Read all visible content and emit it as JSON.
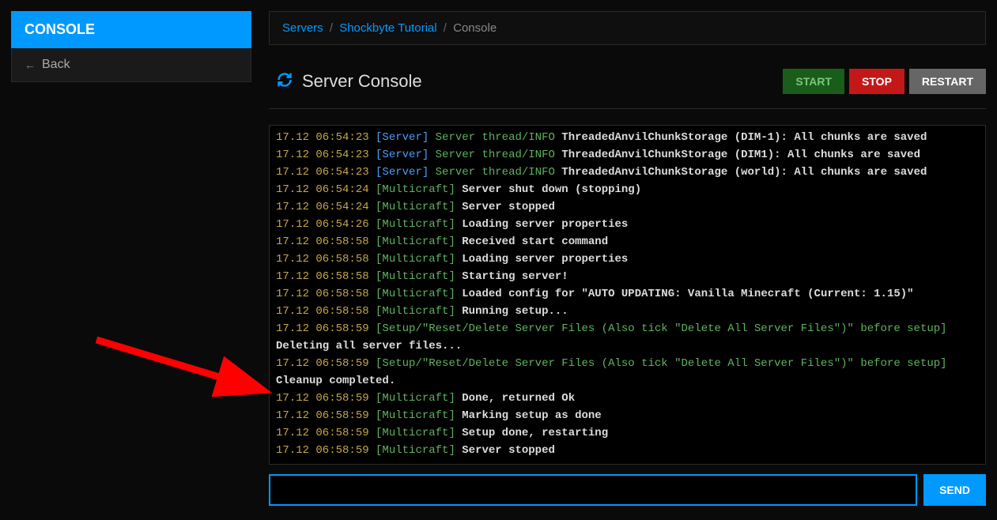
{
  "sidebar": {
    "title": "CONSOLE",
    "back_label": "Back"
  },
  "breadcrumb": {
    "servers": "Servers",
    "server_name": "Shockbyte Tutorial",
    "current": "Console"
  },
  "header": {
    "title": "Server Console",
    "start": "START",
    "stop": "STOP",
    "restart": "RESTART"
  },
  "input": {
    "send": "SEND"
  },
  "logs": [
    {
      "ts": "17.12 06:54:23",
      "tag": "[Server]",
      "tag_class": "tag-server",
      "thread": "Server thread/INFO",
      "msg": "ThreadedAnvilChunkStorage (world): All chunks are saved",
      "partial": true
    },
    {
      "ts": "17.12 06:54:23",
      "tag": "[Server]",
      "tag_class": "tag-server",
      "thread": "Server thread/INFO",
      "msg": "ThreadedAnvilChunkStorage (DIM-1): All chunks are saved"
    },
    {
      "ts": "17.12 06:54:23",
      "tag": "[Server]",
      "tag_class": "tag-server",
      "thread": "Server thread/INFO",
      "msg": "ThreadedAnvilChunkStorage (DIM1): All chunks are saved"
    },
    {
      "ts": "17.12 06:54:23",
      "tag": "[Server]",
      "tag_class": "tag-server",
      "thread": "Server thread/INFO",
      "msg": "ThreadedAnvilChunkStorage (world): All chunks are saved"
    },
    {
      "ts": "17.12 06:54:24",
      "tag": "[Multicraft]",
      "tag_class": "tag-multi",
      "msg": "Server shut down (stopping)"
    },
    {
      "ts": "17.12 06:54:24",
      "tag": "[Multicraft]",
      "tag_class": "tag-multi",
      "msg": "Server stopped"
    },
    {
      "ts": "17.12 06:54:26",
      "tag": "[Multicraft]",
      "tag_class": "tag-multi",
      "msg": "Loading server properties"
    },
    {
      "ts": "17.12 06:58:58",
      "tag": "[Multicraft]",
      "tag_class": "tag-multi",
      "msg": "Received start command"
    },
    {
      "ts": "17.12 06:58:58",
      "tag": "[Multicraft]",
      "tag_class": "tag-multi",
      "msg": "Loading server properties"
    },
    {
      "ts": "17.12 06:58:58",
      "tag": "[Multicraft]",
      "tag_class": "tag-multi",
      "msg": "Starting server!"
    },
    {
      "ts": "17.12 06:58:58",
      "tag": "[Multicraft]",
      "tag_class": "tag-multi",
      "msg": "Loaded config for \"AUTO UPDATING: Vanilla Minecraft (Current: 1.15)\""
    },
    {
      "ts": "17.12 06:58:58",
      "tag": "[Multicraft]",
      "tag_class": "tag-multi",
      "msg": "Running setup..."
    },
    {
      "ts": "17.12 06:58:59",
      "tag": "[Setup/\"Reset/Delete Server Files (Also tick \"Delete All Server Files\")\" before setup]",
      "tag_class": "tag-setup",
      "msg": ""
    },
    {
      "plain": "Deleting all server files..."
    },
    {
      "ts": "17.12 06:58:59",
      "tag": "[Setup/\"Reset/Delete Server Files (Also tick \"Delete All Server Files\")\" before setup]",
      "tag_class": "tag-setup",
      "msg": ""
    },
    {
      "plain": "Cleanup completed."
    },
    {
      "ts": "17.12 06:58:59",
      "tag": "[Multicraft]",
      "tag_class": "tag-multi",
      "msg": "Done, returned Ok"
    },
    {
      "ts": "17.12 06:58:59",
      "tag": "[Multicraft]",
      "tag_class": "tag-multi",
      "msg": "Marking setup as done"
    },
    {
      "ts": "17.12 06:58:59",
      "tag": "[Multicraft]",
      "tag_class": "tag-multi",
      "msg": "Setup done, restarting"
    },
    {
      "ts": "17.12 06:58:59",
      "tag": "[Multicraft]",
      "tag_class": "tag-multi",
      "msg": "Server stopped"
    }
  ]
}
